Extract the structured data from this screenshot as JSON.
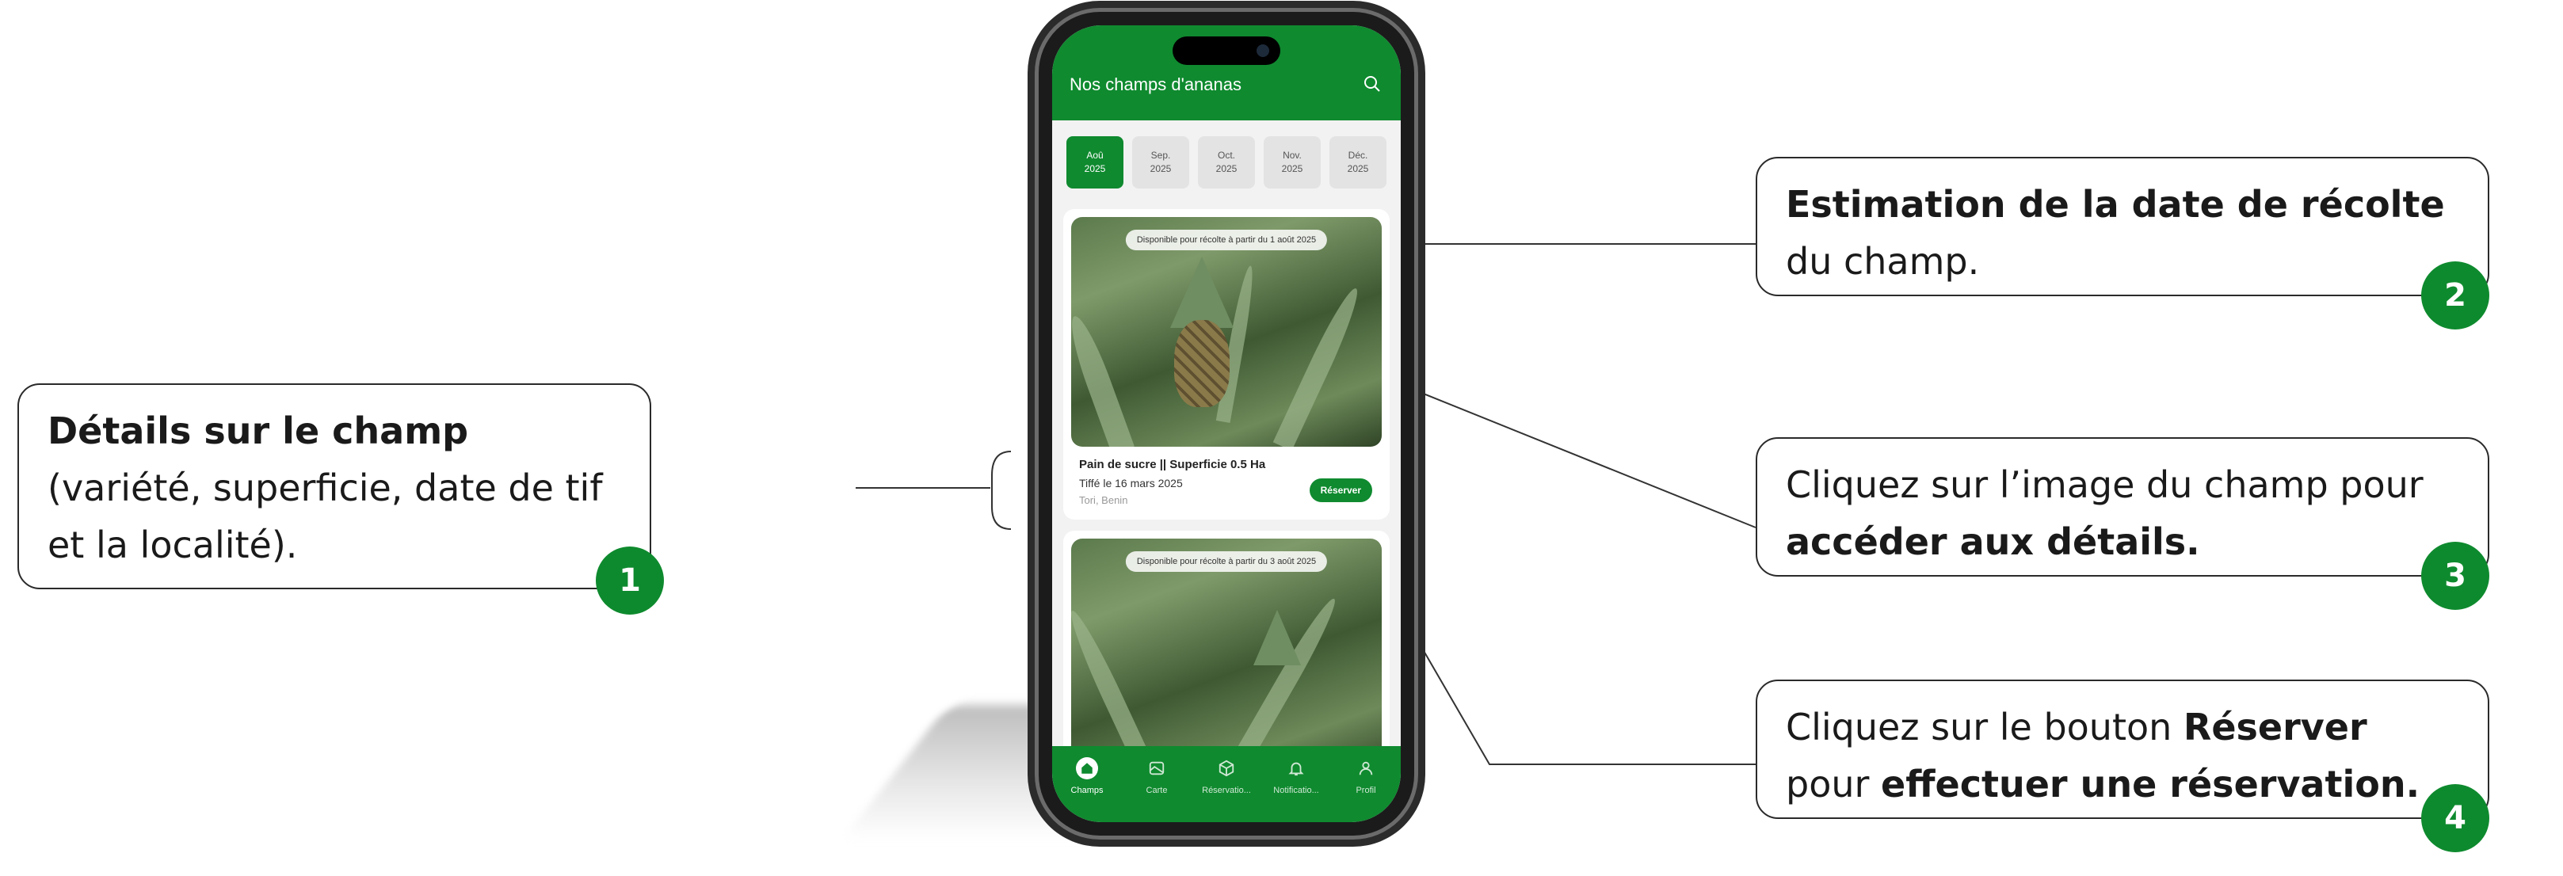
{
  "app": {
    "title": "Nos champs d'ananas"
  },
  "months": [
    {
      "line1": "Aoû",
      "line2": "2025",
      "active": true
    },
    {
      "line1": "Sep.",
      "line2": "2025",
      "active": false
    },
    {
      "line1": "Oct.",
      "line2": "2025",
      "active": false
    },
    {
      "line1": "Nov.",
      "line2": "2025",
      "active": false
    },
    {
      "line1": "Déc.",
      "line2": "2025",
      "active": false
    }
  ],
  "cards": [
    {
      "availability": "Disponible pour récolte à partir du 1 août 2025",
      "title": "Pain de sucre || Superficie 0.5 Ha",
      "tif_date": "Tiffé le 16 mars 2025",
      "location": "Tori, Benin",
      "reserve_label": "Réserver"
    },
    {
      "availability": "Disponible pour récolte à partir du 3 août 2025"
    }
  ],
  "nav": [
    {
      "label": "Champs",
      "icon": "home-icon",
      "active": true
    },
    {
      "label": "Carte",
      "icon": "map-icon",
      "active": false
    },
    {
      "label": "Réservatio...",
      "icon": "box-icon",
      "active": false
    },
    {
      "label": "Notificatio...",
      "icon": "bell-icon",
      "active": false
    },
    {
      "label": "Profil",
      "icon": "user-icon",
      "active": false
    }
  ],
  "callouts": {
    "c1": {
      "bold": "Détails sur le champ",
      "rest": " (variété, superficie, date de tif et la localité).",
      "badge": "1"
    },
    "c2": {
      "bold": "Estimation de la date de récolte",
      "rest": " du champ.",
      "badge": "2"
    },
    "c3": {
      "rest": "Cliquez sur l’image du champ pour ",
      "bold": "accéder aux détails.",
      "badge": "3"
    },
    "c4": {
      "rest": "Cliquez sur le bouton ",
      "bold": "Réserver",
      "rest2": " pour ",
      "bold2": "effectuer une réservation.",
      "badge": "4"
    }
  },
  "colors": {
    "brand_green": "#0f8a2f",
    "badge_green": "#0e8a2e"
  }
}
